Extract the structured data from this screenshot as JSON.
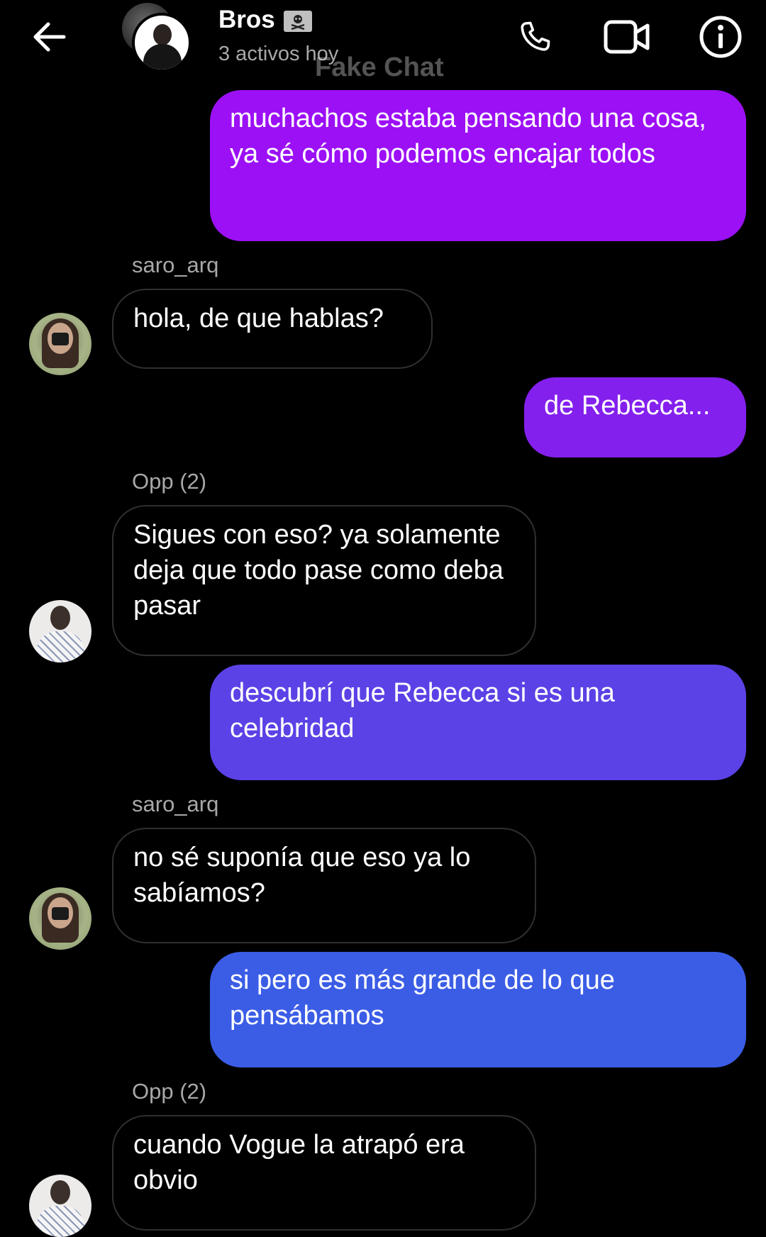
{
  "header": {
    "group_name": "Bros",
    "status": "3 activos hoy",
    "watermark": "Fake Chat",
    "icons": {
      "back": "back-arrow-icon",
      "group_badge": "pirate-flag-icon",
      "call": "phone-icon",
      "video": "video-camera-icon",
      "info": "info-icon"
    }
  },
  "messages": [
    {
      "direction": "outgoing",
      "text": "muchachos estaba pensando una cosa, ya sé cómo podemos encajar todos",
      "color": "#9C10F6"
    },
    {
      "direction": "incoming",
      "sender": "saro_arq",
      "text": "hola, de que hablas?"
    },
    {
      "direction": "outgoing",
      "text": "de Rebecca...",
      "color": "#8420EE"
    },
    {
      "direction": "incoming",
      "sender": "Opp (2)",
      "text": "Sigues con eso? ya solamente deja que todo pase como deba pasar"
    },
    {
      "direction": "outgoing",
      "text": "descubrí que Rebecca si es una celebridad",
      "color": "#5B42E6"
    },
    {
      "direction": "incoming",
      "sender": "saro_arq",
      "text": "no sé suponía que eso ya lo sabíamos?"
    },
    {
      "direction": "outgoing",
      "text": "si pero es más grande de lo que pensábamos",
      "color": "#3B5DE6"
    },
    {
      "direction": "incoming",
      "sender": "Opp (2)",
      "text": "cuando Vogue la atrapó era obvio"
    }
  ],
  "colors": {
    "background": "#000000",
    "secondary_text": "#A8A8A8",
    "incoming_border": "#2F2F2F"
  }
}
